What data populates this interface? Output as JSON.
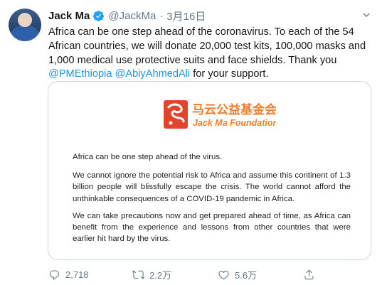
{
  "tweet": {
    "author_name": "Jack Ma",
    "handle": "@JackMa",
    "separator": "·",
    "date": "3月16日",
    "text_lines": [
      "Africa can be one step ahead of the coronavirus. To each of the 54",
      "African countries, we will donate 20,000 test kits, 100,000 masks and",
      "1,000 medical use protective suits and face shields. Thank you"
    ],
    "mention_1": "@PMEthiopia",
    "mention_2": "@AbiyAhmedAli",
    "text_tail": " for your support."
  },
  "card": {
    "logo_cn": "马云公益基金会",
    "logo_en": "Jack Ma Foundation",
    "paragraphs": [
      "Africa can be one step ahead of the virus.",
      "We cannot ignore the potential risk to Africa and assume this continent of 1.3 billion people will blissfully escape the crisis. The world cannot afford the unthinkable consequences of a COVID-19 pandemic in Africa.",
      "We can take precautions now and get prepared ahead of time, as Africa can benefit from the experience and lessons from other countries that were earlier hit hard by the virus."
    ]
  },
  "actions": {
    "replies": "2,718",
    "retweets": "2.2万",
    "likes": "5.6万"
  },
  "colors": {
    "link": "#1b95e0",
    "verified": "#1da1f2",
    "muted": "#657786",
    "logo_red": "#e0452b",
    "logo_orange": "#ef7d2a"
  },
  "icons": [
    "verified-badge-icon",
    "chevron-down-icon",
    "reply-icon",
    "retweet-icon",
    "like-icon",
    "share-icon"
  ]
}
